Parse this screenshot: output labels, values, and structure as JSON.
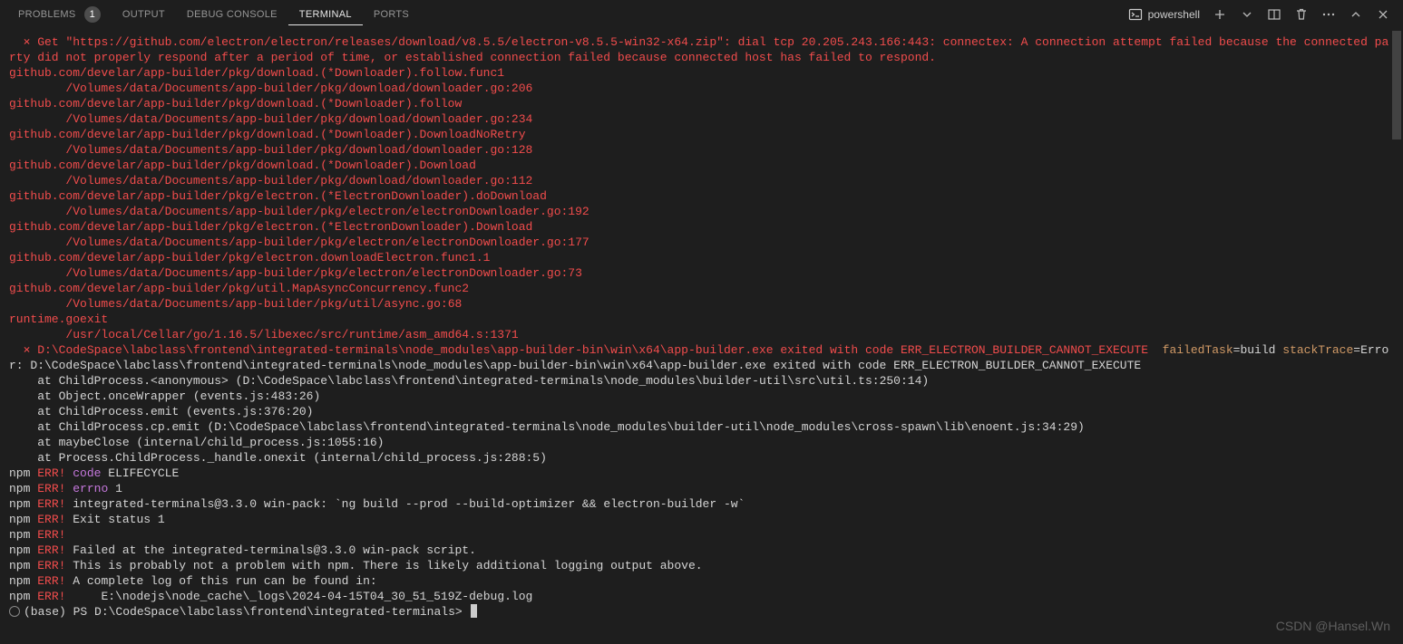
{
  "header": {
    "tabs": [
      {
        "label": "PROBLEMS",
        "badge": "1"
      },
      {
        "label": "OUTPUT"
      },
      {
        "label": "DEBUG CONSOLE"
      },
      {
        "label": "TERMINAL",
        "active": true
      },
      {
        "label": "PORTS"
      }
    ],
    "shell": "powershell"
  },
  "terminal": {
    "error_header": "  ⨯ Get \"https://github.com/electron/electron/releases/download/v8.5.5/electron-v8.5.5-win32-x64.zip\": dial tcp 20.205.243.166:443: connectex: A connection attempt failed because the connected party did not properly respond after a period of time, or established connection failed because connected host has failed to respond.",
    "stack_lines": [
      "github.com/develar/app-builder/pkg/download.(*Downloader).follow.func1",
      "        /Volumes/data/Documents/app-builder/pkg/download/downloader.go:206",
      "github.com/develar/app-builder/pkg/download.(*Downloader).follow",
      "        /Volumes/data/Documents/app-builder/pkg/download/downloader.go:234",
      "github.com/develar/app-builder/pkg/download.(*Downloader).DownloadNoRetry",
      "        /Volumes/data/Documents/app-builder/pkg/download/downloader.go:128",
      "github.com/develar/app-builder/pkg/download.(*Downloader).Download",
      "        /Volumes/data/Documents/app-builder/pkg/download/downloader.go:112",
      "github.com/develar/app-builder/pkg/electron.(*ElectronDownloader).doDownload",
      "        /Volumes/data/Documents/app-builder/pkg/electron/electronDownloader.go:192",
      "github.com/develar/app-builder/pkg/electron.(*ElectronDownloader).Download",
      "        /Volumes/data/Documents/app-builder/pkg/electron/electronDownloader.go:177",
      "github.com/develar/app-builder/pkg/electron.downloadElectron.func1.1",
      "        /Volumes/data/Documents/app-builder/pkg/electron/electronDownloader.go:73",
      "github.com/develar/app-builder/pkg/util.MapAsyncConcurrency.func2",
      "        /Volumes/data/Documents/app-builder/pkg/util/async.go:68",
      "runtime.goexit",
      "        /usr/local/Cellar/go/1.16.5/libexec/src/runtime/asm_amd64.s:1371"
    ],
    "error2_prefix": "  ⨯ D:\\CodeSpace\\labclass\\frontend\\integrated-terminals\\node_modules\\app-builder-bin\\win\\x64\\app-builder.exe exited with code ERR_ELECTRON_BUILDER_CANNOT_EXECUTE  ",
    "error2_ft_label": "failedTask",
    "error2_ft_val": "=build ",
    "error2_st_label": "stackTrace",
    "error2_st_val": "=Error: D:\\CodeSpace\\labclass\\frontend\\integrated-terminals\\node_modules\\app-builder-bin\\win\\x64\\app-builder.exe exited with code ERR_ELECTRON_BUILDER_CANNOT_EXECUTE",
    "js_stack": [
      "    at ChildProcess.<anonymous> (D:\\CodeSpace\\labclass\\frontend\\integrated-terminals\\node_modules\\builder-util\\src\\util.ts:250:14)",
      "    at Object.onceWrapper (events.js:483:26)",
      "    at ChildProcess.emit (events.js:376:20)",
      "    at ChildProcess.cp.emit (D:\\CodeSpace\\labclass\\frontend\\integrated-terminals\\node_modules\\builder-util\\node_modules\\cross-spawn\\lib\\enoent.js:34:29)",
      "    at maybeClose (internal/child_process.js:1055:16)",
      "    at Process.ChildProcess._handle.onexit (internal/child_process.js:288:5)"
    ],
    "npm_lines": [
      {
        "tag": "code",
        "msg": " ELIFECYCLE",
        "tagcolor": "magenta"
      },
      {
        "tag": "errno",
        "msg": " 1",
        "tagcolor": "magenta"
      },
      {
        "tag": "",
        "msg": " integrated-terminals@3.3.0 win-pack: `ng build --prod --build-optimizer && electron-builder -w`"
      },
      {
        "tag": "",
        "msg": " Exit status 1"
      },
      {
        "tag": "",
        "msg": ""
      },
      {
        "tag": "",
        "msg": " Failed at the integrated-terminals@3.3.0 win-pack script."
      },
      {
        "tag": "",
        "msg": " This is probably not a problem with npm. There is likely additional logging output above."
      },
      {
        "blank": true
      },
      {
        "tag": "",
        "msg": " A complete log of this run can be found in:"
      },
      {
        "tag": "",
        "msg": "     E:\\nodejs\\node_cache\\_logs\\2024-04-15T04_30_51_519Z-debug.log"
      }
    ],
    "prompt": "(base) PS D:\\CodeSpace\\labclass\\frontend\\integrated-terminals> "
  },
  "watermark": "CSDN @Hansel.Wn"
}
